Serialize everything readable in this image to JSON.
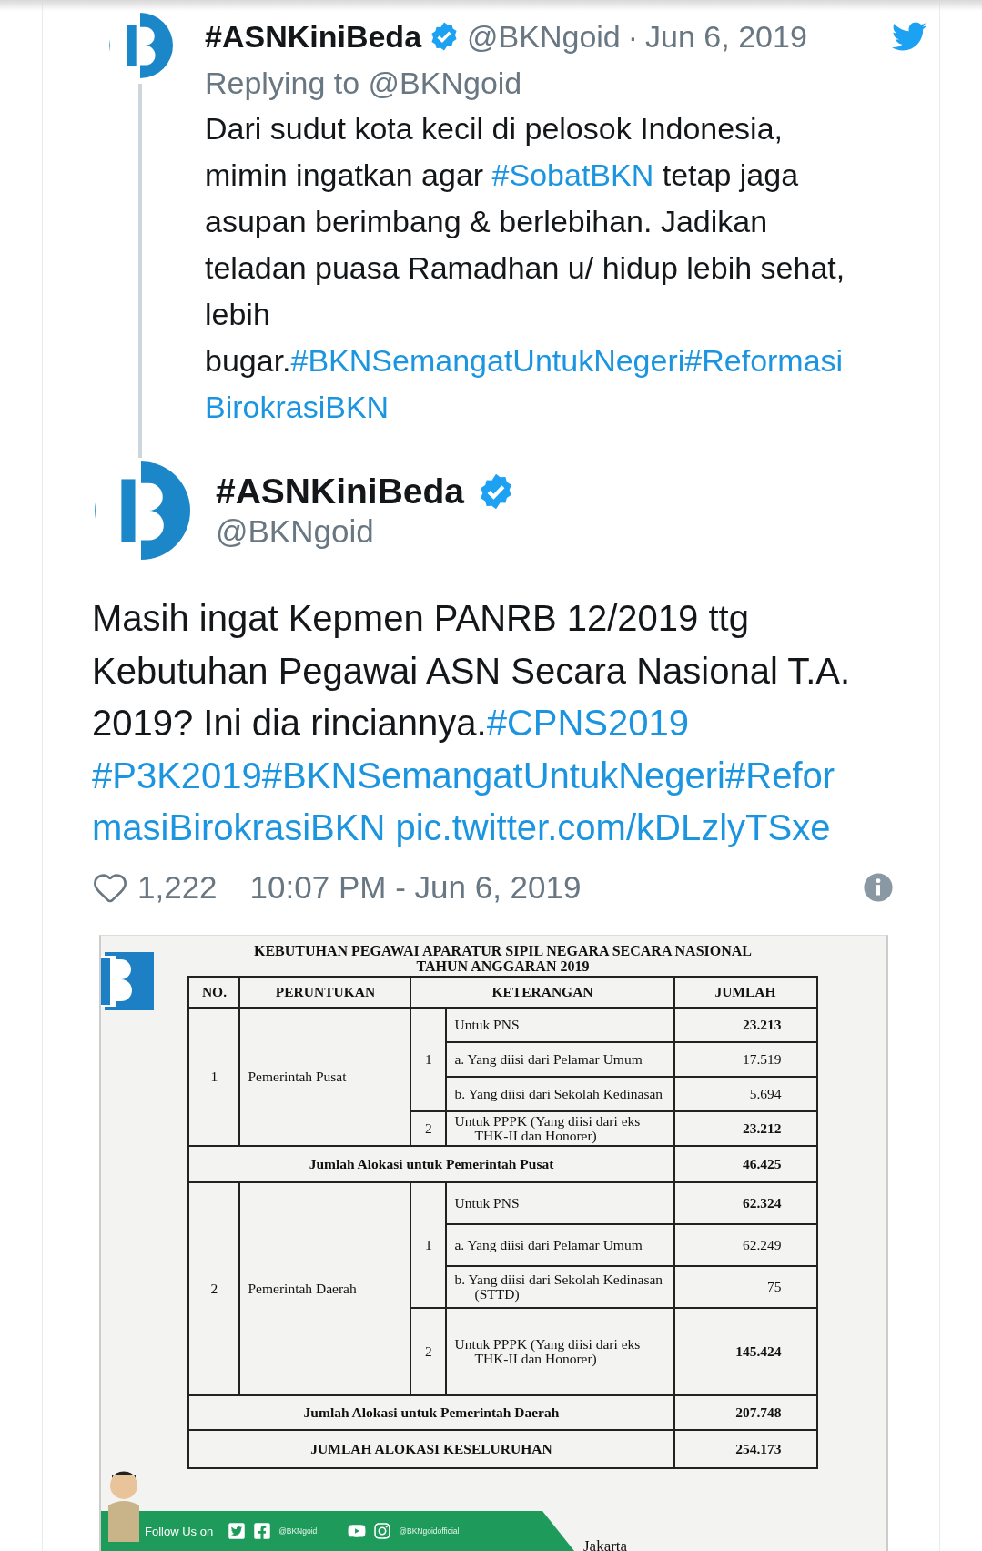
{
  "reply_tweet": {
    "author": {
      "name": "#ASNKiniBeda",
      "verified": true,
      "handle": "@BKNgoid"
    },
    "separator": "·",
    "date": "Jun 6, 2019",
    "replying_to": "Replying to @BKNgoid",
    "text_lines": [
      [
        {
          "text": "Dari sudut kota kecil di pelosok Indonesia,",
          "kind": "text"
        }
      ],
      [
        {
          "text": "mimin ingatkan agar ",
          "kind": "text"
        },
        {
          "text": "#SobatBKN",
          "kind": "link"
        },
        {
          "text": " tetap jaga",
          "kind": "text"
        }
      ],
      [
        {
          "text": "asupan berimbang & berlebihan. Jadikan",
          "kind": "text"
        }
      ],
      [
        {
          "text": "teladan puasa Ramadhan u/ hidup lebih sehat,",
          "kind": "text"
        }
      ],
      [
        {
          "text": "lebih",
          "kind": "text"
        }
      ],
      [
        {
          "text": "bugar.",
          "kind": "text"
        },
        {
          "text": "#BKNSemangatUntukNegeri#Reformasi",
          "kind": "link"
        }
      ],
      [
        {
          "text": "BirokrasiBKN",
          "kind": "link"
        }
      ]
    ]
  },
  "main_tweet": {
    "author": {
      "name": "#ASNKiniBeda",
      "verified": true,
      "handle": "@BKNgoid"
    },
    "text_lines": [
      [
        {
          "text": "Masih ingat Kepmen PANRB 12/2019 ttg",
          "kind": "text"
        }
      ],
      [
        {
          "text": "Kebutuhan Pegawai ASN Secara Nasional T.A.",
          "kind": "text"
        }
      ],
      [
        {
          "text": "2019? Ini dia rinciannya.",
          "kind": "text"
        },
        {
          "text": "#CPNS2019",
          "kind": "link"
        }
      ],
      [
        {
          "text": "#P3K2019#BKNSemangatUntukNegeri#Refor",
          "kind": "link"
        }
      ],
      [
        {
          "text": "masiBirokrasiBKN",
          "kind": "link"
        },
        {
          "text": "pic.twitter.com/kDLzlyTSxe",
          "kind": "link"
        }
      ]
    ],
    "likes": "1,222",
    "timestamp": "10:07 PM - Jun 6, 2019",
    "attached_document": {
      "title_lines": [
        "KEBUTUHAN PEGAWAI APARATUR SIPIL NEGARA SECARA NASIONAL",
        "TAHUN ANGGARAN 2019"
      ],
      "columns": [
        "NO.",
        "PERUNTUKAN",
        "KETERANGAN",
        "JUMLAH"
      ],
      "sections": [
        {
          "no": "1",
          "peruntukan": "Pemerintah Pusat",
          "groups": [
            {
              "sub": "1",
              "items": [
                {
                  "label": "Untuk PNS",
                  "value": "23.213",
                  "bold": true
                },
                {
                  "label": "a. Yang diisi dari Pelamar Umum",
                  "value": "17.519",
                  "bold": false
                },
                {
                  "label": "b. Yang diisi dari Sekolah Kedinasan",
                  "value": "5.694",
                  "bold": false
                }
              ]
            },
            {
              "sub": "2",
              "items": [
                {
                  "label": "Untuk PPPK (Yang diisi dari eks THK-II dan Honorer)",
                  "value": "23.212",
                  "bold": true
                }
              ]
            }
          ],
          "total": {
            "label": "Jumlah Alokasi untuk Pemerintah Pusat",
            "value": "46.425"
          }
        },
        {
          "no": "2",
          "peruntukan": "Pemerintah Daerah",
          "groups": [
            {
              "sub": "1",
              "items": [
                {
                  "label": "Untuk PNS",
                  "value": "62.324",
                  "bold": true
                },
                {
                  "label": "a. Yang diisi dari Pelamar Umum",
                  "value": "62.249",
                  "bold": false
                },
                {
                  "label": "b. Yang diisi dari Sekolah Kedinasan (STTD)",
                  "value": "75",
                  "bold": false
                }
              ]
            },
            {
              "sub": "2",
              "items": [
                {
                  "label": "Untuk PPPK (Yang diisi dari eks THK-II dan Honorer)",
                  "value": "145.424",
                  "bold": true
                }
              ]
            }
          ],
          "total": {
            "label": "Jumlah Alokasi untuk Pemerintah Daerah",
            "value": "207.748"
          }
        }
      ],
      "grand_total": {
        "label": "JUMLAH ALOKASI KESELURUHAN",
        "value": "254.173"
      },
      "banner": {
        "label": "Follow Us on",
        "handles": [
          "@BKNgoid",
          "@BKNgoidofficial"
        ]
      },
      "footer_text": "Jakarta"
    }
  }
}
